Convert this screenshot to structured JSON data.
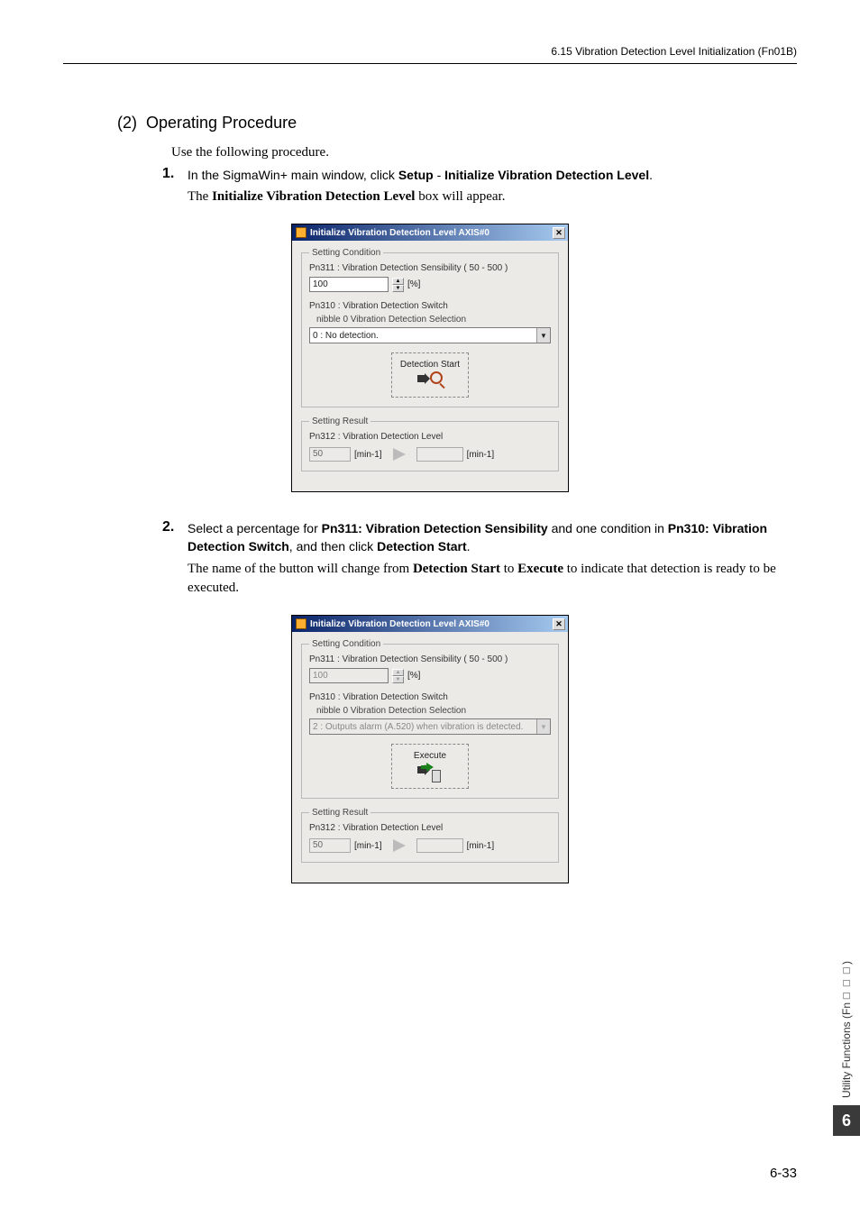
{
  "header": "6.15  Vibration Detection Level Initialization (Fn01B)",
  "section": {
    "num": "(2)",
    "title": "Operating Procedure"
  },
  "intro": "Use the following procedure.",
  "step1": {
    "num": "1.",
    "line1a": "In the SigmaWin+ main window, click ",
    "b1": "Setup",
    "dash": " - ",
    "b2": "Initialize Vibration Detection Level",
    "dot": ".",
    "line2a": "The ",
    "b3": "Initialize Vibration Detection Level",
    "line2b": " box will appear."
  },
  "step2": {
    "num": "2.",
    "line1a": "Select a percentage for ",
    "b1": "Pn311: Vibration Detection Sensibility",
    "line1b": " and one condition in ",
    "b2": "Pn310: Vibration Detection Switch",
    "line1c": ", and then click ",
    "b3": "Detection Start",
    "dot": ".",
    "line2a": "The name of the button will change from ",
    "b4": "Detection Start",
    "line2b": " to ",
    "b5": "Execute",
    "line2c": " to indicate that detection is ready to be executed."
  },
  "dialog": {
    "title": "Initialize Vibration Detection Level AXIS#0",
    "groupCond": "Setting Condition",
    "pn311": "Pn311 : Vibration Detection Sensibility  ( 50 - 500 )",
    "pn311_val": "100",
    "pct": "[%]",
    "pn310": "Pn310 : Vibration Detection Switch",
    "nibble": "nibble 0 Vibration Detection Selection",
    "combo_a": "0 : No detection.",
    "combo_b": "2 : Outputs alarm (A.520) when vibration is detected.",
    "btn_detect": "Detection Start",
    "btn_exec": "Execute",
    "groupRes": "Setting Result",
    "pn312": "Pn312 : Vibration Detection Level",
    "pn312_val": "50",
    "unit_min": "[min-1]"
  },
  "side": {
    "label": "Utility Functions (Fn□□□)",
    "num": "6"
  },
  "pagenum": "6-33"
}
